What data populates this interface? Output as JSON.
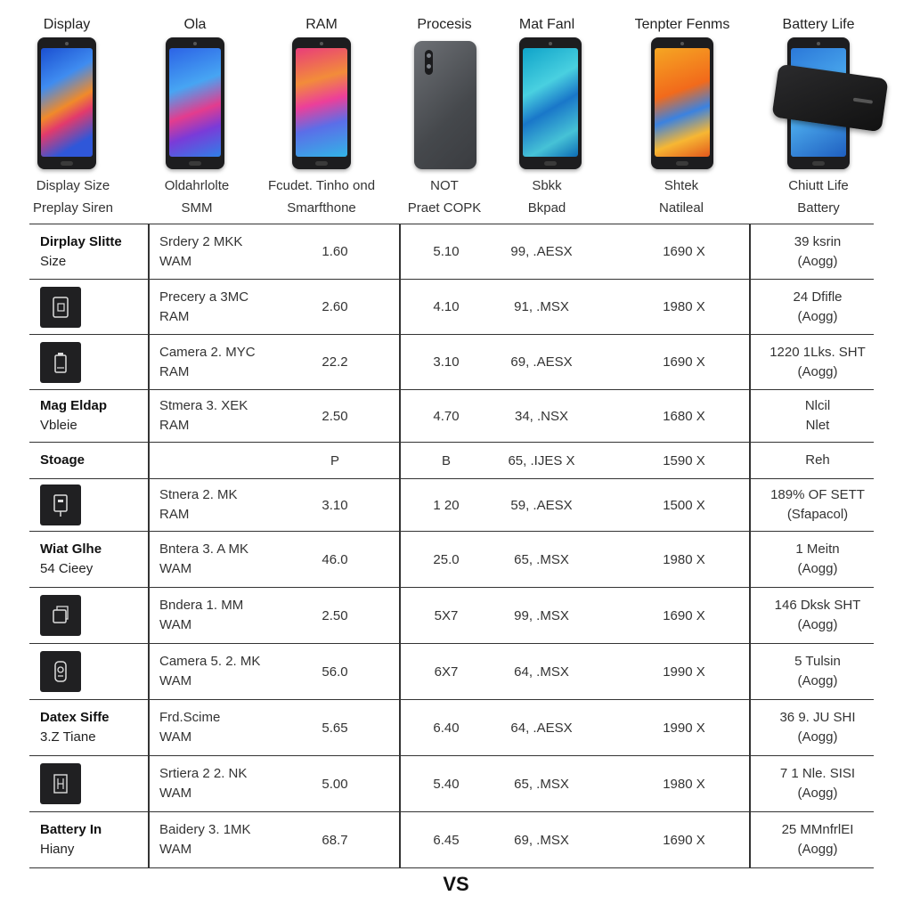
{
  "header": {
    "columns": [
      {
        "title": "Display",
        "sub1": "Display Size",
        "sub2": "Preplay Siren",
        "screen": "display-screen"
      },
      {
        "title": "Ola",
        "sub1": "Oldahrlolte",
        "sub2": "SMM",
        "screen": "blue-screen"
      },
      {
        "title": "RAM",
        "sub1": "Fcudet. Tinho ond",
        "sub2": "Smarfthone",
        "screen": "pink-screen"
      },
      {
        "title": "Procesis",
        "sub1": "NOT",
        "sub2": "Praet COPK",
        "screen": "back-panel"
      },
      {
        "title": "Mat Fanl",
        "sub1": "Sbkk",
        "sub2": "Bkpad",
        "screen": "teal-screen"
      },
      {
        "title": "Tenpter Fenms",
        "sub1": "Shtek",
        "sub2": "Natileal",
        "screen": "orange-screen"
      },
      {
        "title": "Battery Life",
        "sub1": "Chiutt Life",
        "sub2": "Battery",
        "screen": "battery-screen"
      }
    ]
  },
  "rows": [
    {
      "label": [
        "Dirplay Slitte",
        "Size"
      ],
      "label_icon": "",
      "spec": [
        "Srdery 2 MKK",
        "WAM"
      ],
      "c3": "1.60",
      "c4": "5.10",
      "c5": "99, .AESX",
      "c6": "1690 X",
      "c7": [
        "39 ksrin",
        "(Aogg)"
      ]
    },
    {
      "label": [],
      "label_icon": "sim-card-icon",
      "spec": [
        "Precery a 3MC",
        "RAM"
      ],
      "c3": "2.60",
      "c4": "4.10",
      "c5": "91, .MSX",
      "c6": "1980 X",
      "c7": [
        "24 Dfifle",
        "(Aogg)"
      ]
    },
    {
      "label": [],
      "label_icon": "battery-icon",
      "spec": [
        "Camera 2. MYC",
        "RAM"
      ],
      "c3": "22.2",
      "c4": "3.10",
      "c5": "69, .AESX",
      "c6": "1690 X",
      "c7": [
        "1220 1Lks. SHT",
        "(Aogg)"
      ]
    },
    {
      "label": [
        "Mag Eldap",
        "Vbleie"
      ],
      "label_icon": "",
      "spec": [
        "Stmera 3. XEK",
        "RAM"
      ],
      "c3": "2.50",
      "c4": "4.70",
      "c5": "34, .NSX",
      "c6": "1680 X",
      "c7": [
        "Nlcil",
        "Nlet"
      ]
    },
    {
      "label": [
        "Stoage"
      ],
      "label_icon": "",
      "spec": [],
      "c3": "P",
      "c4": "B",
      "c5": "65, .IJES X",
      "c6": "1590 X",
      "c7": [
        "Reh"
      ]
    },
    {
      "label": [],
      "label_icon": "charger-icon",
      "spec": [
        "Stnera 2. MK",
        "RAM"
      ],
      "c3": "3.10",
      "c4": "1 20",
      "c5": "59, .AESX",
      "c6": "1500 X",
      "c7": [
        "189% OF SETT",
        "(Sfapacol)"
      ]
    },
    {
      "label": [
        "Wiat Glhe",
        "54 Cieey"
      ],
      "label_icon": "",
      "spec": [
        "Bntera 3. A MK",
        "WAM"
      ],
      "c3": "46.0",
      "c4": "25.0",
      "c5": "65, .MSX",
      "c6": "1980 X",
      "c7": [
        "1 Meitn",
        "(Aogg)"
      ]
    },
    {
      "label": [],
      "label_icon": "device-icon",
      "spec": [
        "Bndera 1. MM",
        "WAM"
      ],
      "c3": "2.50",
      "c4": "5X7",
      "c5": "99, .MSX",
      "c6": "1690 X",
      "c7": [
        "146 Dksk SHT",
        "(Aogg)"
      ]
    },
    {
      "label": [],
      "label_icon": "camera-icon",
      "spec": [
        "Camera 5. 2. MK",
        "WAM"
      ],
      "c3": "56.0",
      "c4": "6X7",
      "c5": "64, .MSX",
      "c6": "1990 X",
      "c7": [
        "5 Tulsin",
        "(Aogg)"
      ]
    },
    {
      "label": [
        "Datex Siffe",
        "3.Z Tiane"
      ],
      "label_icon": "",
      "spec": [
        "Frd.Scime",
        "WAM"
      ],
      "c3": "5.65",
      "c4": "6.40",
      "c5": "64, .AESX",
      "c6": "1990 X",
      "c7": [
        "36 9. JU SHI",
        "(Aogg)"
      ]
    },
    {
      "label": [],
      "label_icon": "chip-icon",
      "spec": [
        "Srtiera 2 2. NK",
        "WAM"
      ],
      "c3": "5.00",
      "c4": "5.40",
      "c5": "65, .MSX",
      "c6": "1980 X",
      "c7": [
        "7 1 Nle. SISI",
        "(Aogg)"
      ]
    },
    {
      "label": [
        "Battery In",
        "Hiany"
      ],
      "label_icon": "",
      "spec": [
        "Baidery 3. 1MK",
        "WAM"
      ],
      "c3": "68.7",
      "c4": "6.45",
      "c5": "69, .MSX",
      "c6": "1690 X",
      "c7": [
        "25 MMnfrlEI",
        "(Aogg)"
      ]
    }
  ],
  "footer": {
    "vs": "VS"
  },
  "colors": {
    "line": "#333333",
    "icon_bg": "#202022"
  }
}
